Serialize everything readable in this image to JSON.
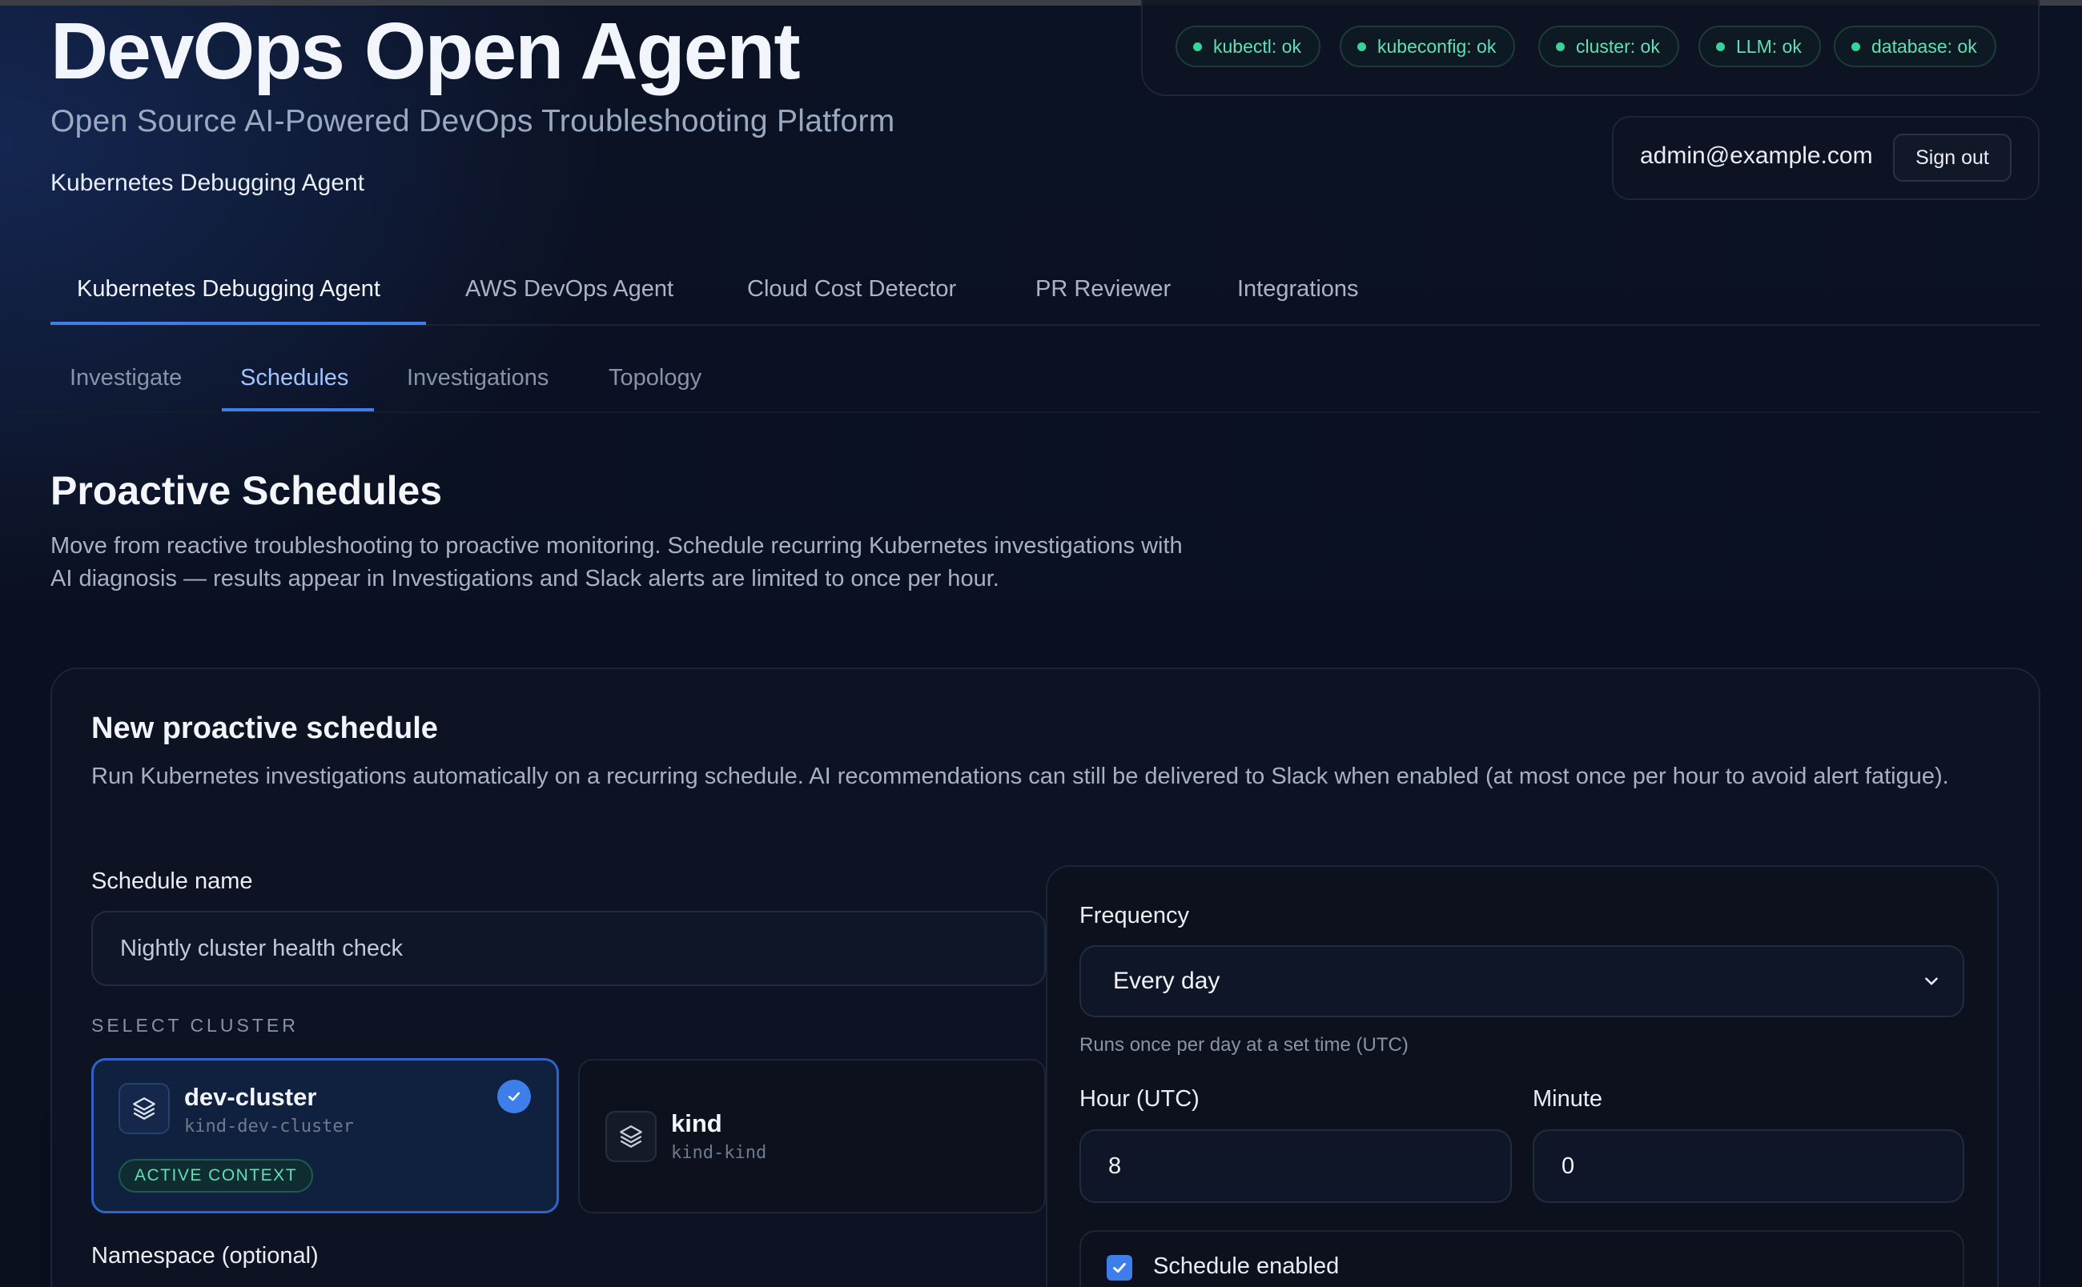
{
  "header": {
    "title": "DevOps Open Agent",
    "subtitle": "Open Source AI-Powered DevOps Troubleshooting Platform",
    "agent_caption": "Kubernetes Debugging Agent"
  },
  "status_chips": [
    {
      "label": "kubectl: ok",
      "status": "ok"
    },
    {
      "label": "kubeconfig: ok",
      "status": "ok"
    },
    {
      "label": "cluster: ok",
      "status": "ok"
    },
    {
      "label": "LLM: ok",
      "status": "ok"
    },
    {
      "label": "database: ok",
      "status": "ok"
    }
  ],
  "user": {
    "email": "admin@example.com",
    "sign_out_label": "Sign out"
  },
  "main_tabs": [
    {
      "label": "Kubernetes Debugging Agent",
      "active": true
    },
    {
      "label": "AWS DevOps Agent",
      "active": false
    },
    {
      "label": "Cloud Cost Detector",
      "active": false
    },
    {
      "label": "PR Reviewer",
      "active": false
    },
    {
      "label": "Integrations",
      "active": false
    }
  ],
  "sub_tabs": [
    {
      "label": "Investigate",
      "active": false
    },
    {
      "label": "Schedules",
      "active": true
    },
    {
      "label": "Investigations",
      "active": false
    },
    {
      "label": "Topology",
      "active": false
    }
  ],
  "section": {
    "title": "Proactive Schedules",
    "description": "Move from reactive troubleshooting to proactive monitoring. Schedule recurring Kubernetes investigations with AI diagnosis — results appear in Investigations and Slack alerts are limited to once per hour."
  },
  "form": {
    "title": "New proactive schedule",
    "description": "Run Kubernetes investigations automatically on a recurring schedule. AI recommendations can still be delivered to Slack when enabled (at most once per hour to avoid alert fatigue).",
    "schedule_name_label": "Schedule name",
    "schedule_name_placeholder": "Nightly cluster health check",
    "select_cluster_label": "SELECT CLUSTER",
    "clusters": [
      {
        "name": "dev-cluster",
        "context": "kind-dev-cluster",
        "selected": true,
        "badge": "ACTIVE CONTEXT"
      },
      {
        "name": "kind",
        "context": "kind-kind",
        "selected": false
      }
    ],
    "namespace_label": "Namespace (optional)",
    "frequency_label": "Frequency",
    "frequency_value": "Every day",
    "frequency_hint": "Runs once per day at a set time (UTC)",
    "hour_label": "Hour (UTC)",
    "hour_value": "8",
    "minute_label": "Minute",
    "minute_value": "0",
    "enabled_label": "Schedule enabled",
    "enabled": true
  },
  "colors": {
    "accent": "#3d7eea",
    "status_ok": "#37d399",
    "background": "#0a0f1d"
  }
}
